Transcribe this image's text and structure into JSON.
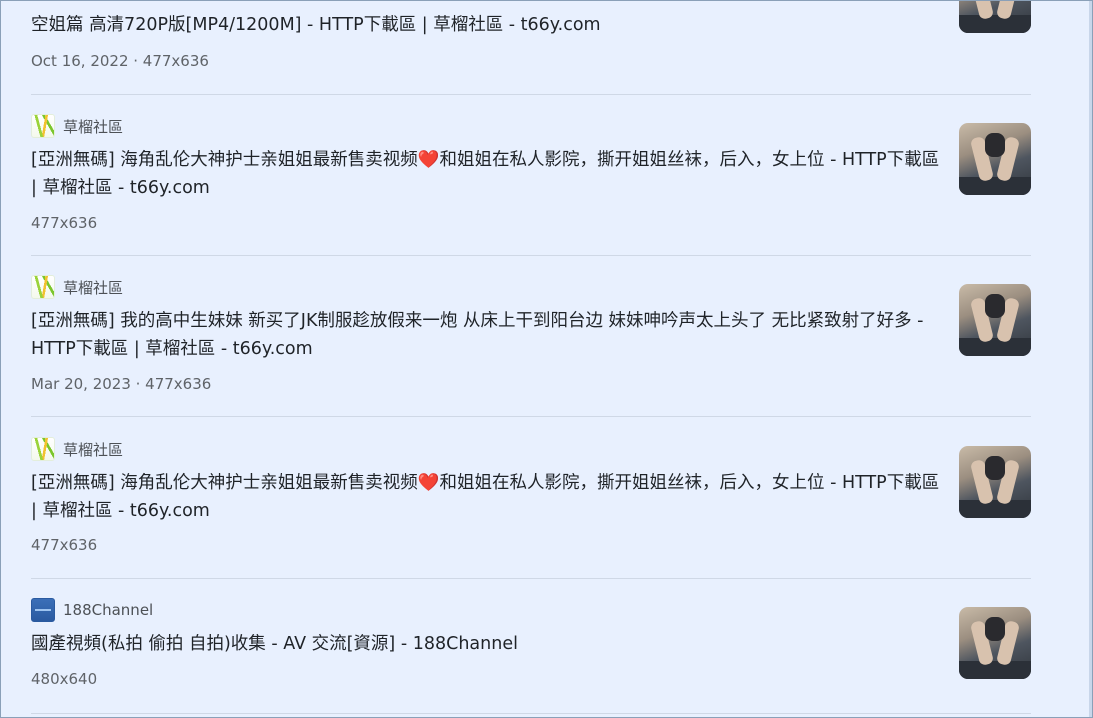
{
  "results": [
    {
      "source": "",
      "favicon": "",
      "title": "空姐篇 高清720P版[MP4/1200M] - HTTP下載區 | 草榴社區 - t66y.com",
      "meta": "Oct 16, 2022 · 477x636"
    },
    {
      "source": "草榴社區",
      "favicon": "caoliu-favicon",
      "title": "[亞洲無碼] 海角乱伦大神护士亲姐姐最新售卖视频❤️和姐姐在私人影院，撕开姐姐丝袜，后入，女上位 - HTTP下載區 | 草榴社區 - t66y.com",
      "meta": "477x636"
    },
    {
      "source": "草榴社區",
      "favicon": "caoliu-favicon",
      "title": "[亞洲無碼] 我的高中生妹妹 新买了JK制服趁放假来一炮 从床上干到阳台边 妹妹呻吟声太上头了 无比紧致射了好多 - HTTP下載區 | 草榴社區 - t66y.com",
      "meta": "Mar 20, 2023 · 477x636"
    },
    {
      "source": "草榴社區",
      "favicon": "caoliu-favicon",
      "title": "[亞洲無碼] 海角乱伦大神护士亲姐姐最新售卖视频❤️和姐姐在私人影院，撕开姐姐丝袜，后入，女上位 - HTTP下載區 | 草榴社區 - t66y.com",
      "meta": "477x636"
    },
    {
      "source": "188Channel",
      "favicon": "188channel-favicon",
      "title": "國產視頻(私拍 偷拍 自拍)收集 - AV 交流[資源] - 188Channel",
      "meta": "480x640"
    }
  ],
  "colors": {
    "background": "#e8f0fe",
    "title_text": "#1f2328",
    "meta_text": "#5f6368",
    "divider": "#cfd8e6"
  }
}
